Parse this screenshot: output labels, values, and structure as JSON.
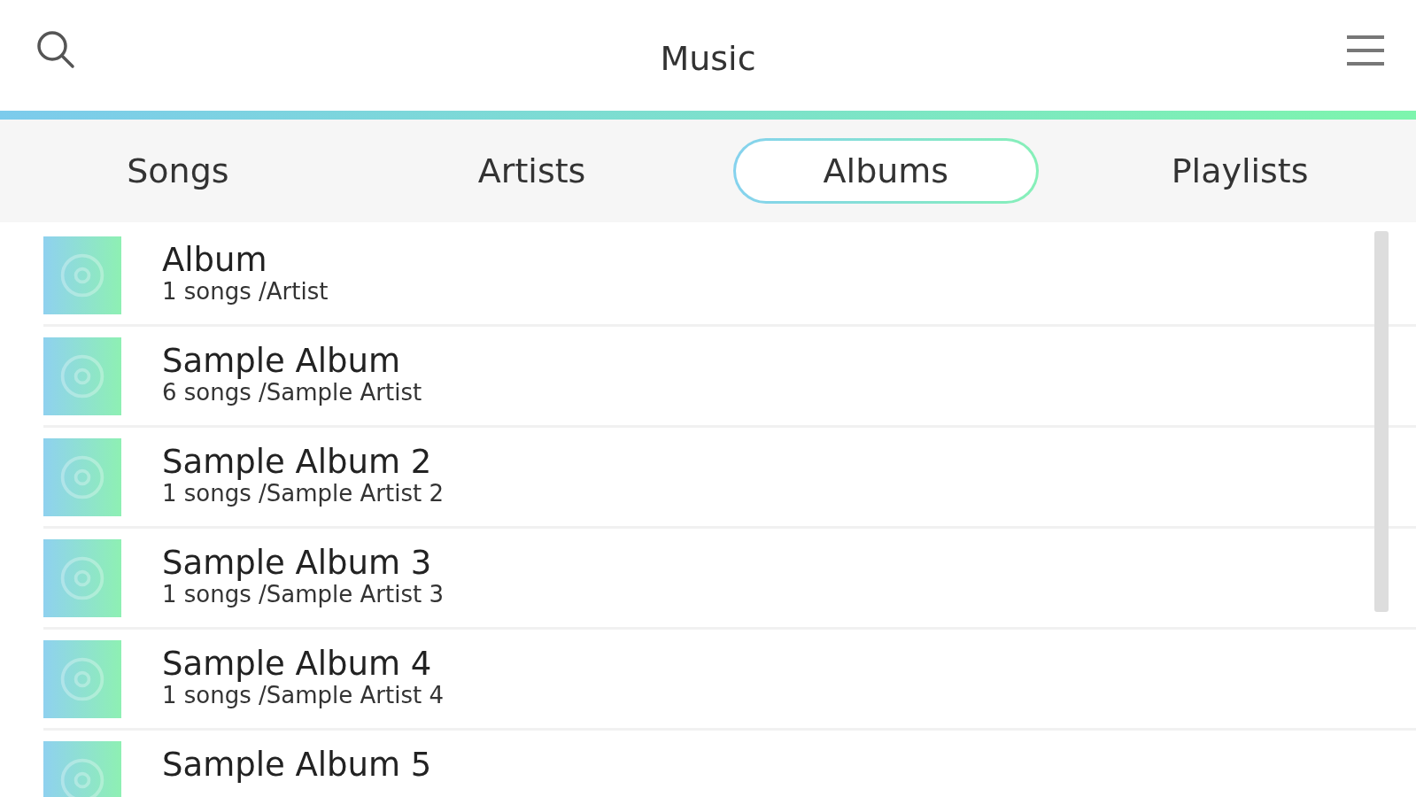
{
  "header": {
    "title": "Music"
  },
  "tabs": [
    {
      "label": "Songs",
      "selected": false
    },
    {
      "label": "Artists",
      "selected": false
    },
    {
      "label": "Albums",
      "selected": true
    },
    {
      "label": "Playlists",
      "selected": false
    }
  ],
  "albums": [
    {
      "title": "Album",
      "subtitle": "1 songs /Artist"
    },
    {
      "title": "Sample Album",
      "subtitle": "6 songs /Sample Artist"
    },
    {
      "title": "Sample Album 2",
      "subtitle": "1 songs /Sample Artist 2"
    },
    {
      "title": "Sample Album 3",
      "subtitle": "1 songs /Sample Artist 3"
    },
    {
      "title": "Sample Album 4",
      "subtitle": "1 songs /Sample Artist 4"
    },
    {
      "title": "Sample Album 5"
    }
  ]
}
